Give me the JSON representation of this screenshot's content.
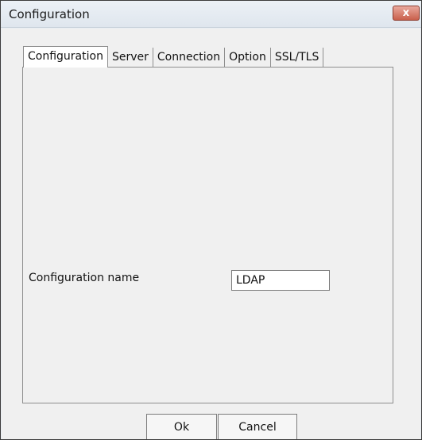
{
  "window": {
    "title": "Configuration",
    "close_glyph": "x"
  },
  "tabs": [
    {
      "label": "Configuration",
      "active": true
    },
    {
      "label": "Server",
      "active": false
    },
    {
      "label": "Connection",
      "active": false
    },
    {
      "label": "Option",
      "active": false
    },
    {
      "label": "SSL/TLS",
      "active": false
    }
  ],
  "form": {
    "configuration_name_label": "Configuration name",
    "configuration_name_value": "LDAP"
  },
  "buttons": {
    "ok_label": "Ok",
    "cancel_label": "Cancel"
  },
  "colors": {
    "close_button": "#c9604c",
    "panel_background": "#f0f0f0"
  }
}
